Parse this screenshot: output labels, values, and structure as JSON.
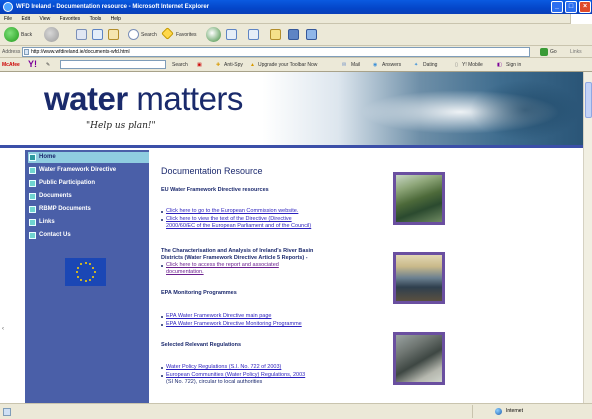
{
  "window": {
    "title": "WFD Ireland - Documentation resource - Microsoft Internet Explorer"
  },
  "menu": [
    "File",
    "Edit",
    "View",
    "Favorites",
    "Tools",
    "Help"
  ],
  "toolbar": {
    "back_label": "Back",
    "search_label": "Search",
    "favorites_label": "Favorites"
  },
  "address": {
    "label": "Address",
    "url": "http://www.wfdireland.ie/documents-wfd.html",
    "go_label": "Go",
    "links_label": "Links"
  },
  "yahoo_toolbar": {
    "mcafee_label": "McAfee",
    "search_label": "Search",
    "antispy_label": "Anti-Spy",
    "upgrade_label": "Upgrade your Toolbar Now",
    "mail_label": "Mail",
    "answers_label": "Answers",
    "dating_label": "Dating",
    "mobile_label": "Y! Mobile",
    "signin_label": "Sign in"
  },
  "site": {
    "logo_word1": "water",
    "logo_word2": " matters",
    "tagline": "\"Help us plan!\""
  },
  "nav": [
    {
      "label": "Home"
    },
    {
      "label": "Water Framework Directive"
    },
    {
      "label": "Public Participation"
    },
    {
      "label": "Documents"
    },
    {
      "label": "RBMP Documents"
    },
    {
      "label": "Links"
    },
    {
      "label": "Contact Us"
    }
  ],
  "main": {
    "title": "Documentation Resource",
    "section1": {
      "heading": "EU Water Framework Directive resources",
      "link1": "Click here to go to the European Commission website.",
      "link2a": "Click here to view the text of the Directive (Directive",
      "link2b": "2000/60/EC of the European Parliament and of the Council)"
    },
    "section2": {
      "heading_a": "The Characterisation and Analysis of Ireland's River Basin",
      "heading_b": "Districts (Water Framework Directive Article 5 Reports) -",
      "link1a": "Click here to access the report and associated",
      "link1b": "documentation."
    },
    "section3": {
      "heading": "EPA Monitoring Programmes",
      "link1": "EPA Water Framework Directive main page",
      "link2": "EPA Water Framework Directive Monitoring Programme"
    },
    "section4": {
      "heading": "Selected Relevant Regulations",
      "link1": "Water Policy Regulations (S.I. No. 722 of 2003)",
      "link2": "European Communities (Water Policy) Regulations, 2003",
      "text1a": "(SI No. 722), ",
      "text1b": "circular to local authorities"
    }
  },
  "status": {
    "zone": "Internet"
  },
  "colors": {
    "nav_bg": "#4a5fa8",
    "nav_active": "#8fcde0",
    "heading": "#1c2a6e",
    "link": "#2a1fbe",
    "visited": "#6b1f8e",
    "photo_border": "#6a4fa0"
  }
}
